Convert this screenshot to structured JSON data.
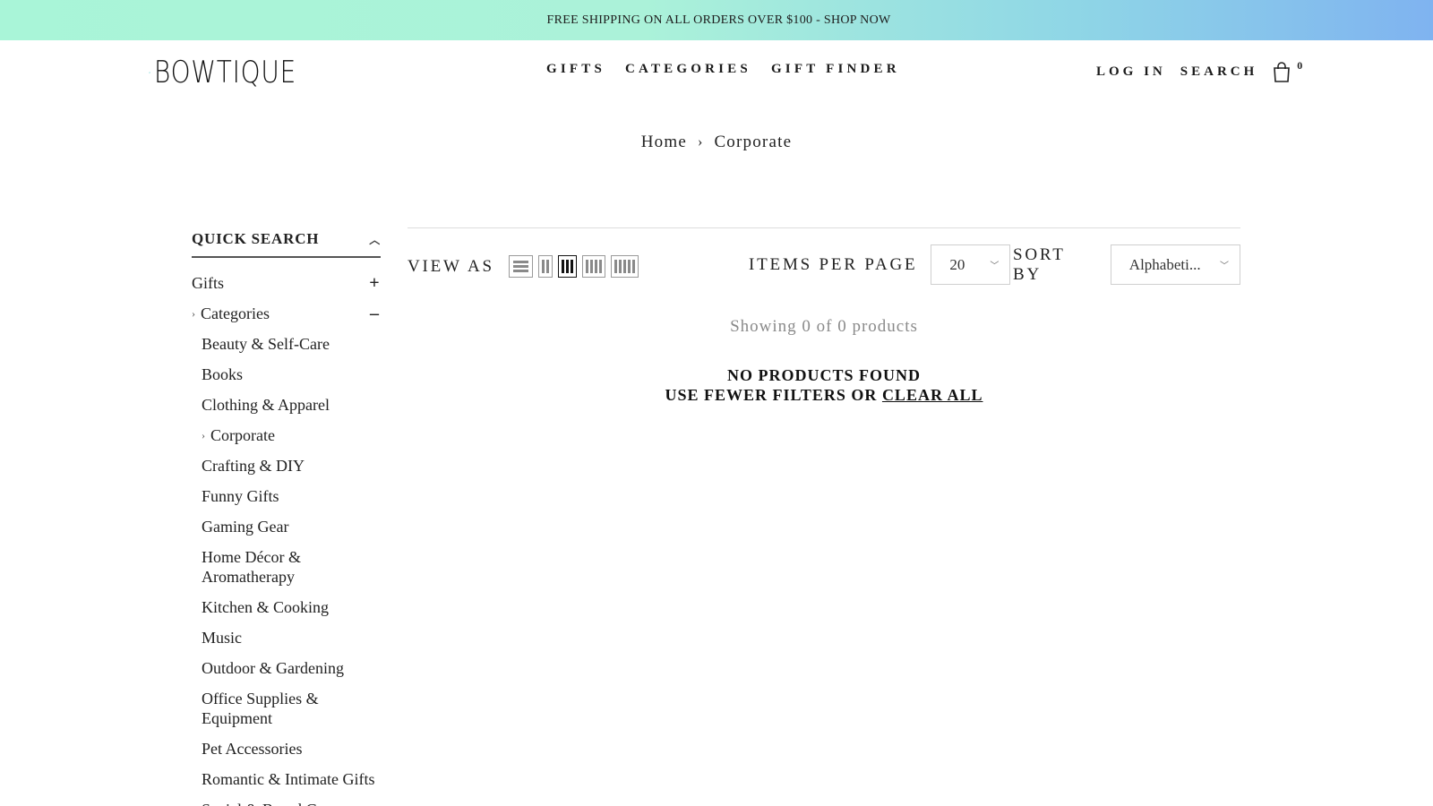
{
  "announcement": {
    "text": "FREE SHIPPING ON ALL ORDERS OVER $100 - SHOP NOW"
  },
  "header": {
    "logo_text": "BOWTIQUE",
    "nav": [
      "GIFTS",
      "CATEGORIES",
      "GIFT FINDER"
    ],
    "login": "LOG IN",
    "search": "SEARCH",
    "cart_count": "0"
  },
  "breadcrumb": {
    "home": "Home",
    "separator": "›",
    "current": "Corporate"
  },
  "sidebar": {
    "quick_search": "QUICK SEARCH",
    "gifts": "Gifts",
    "gifts_toggle": "+",
    "categories": "Categories",
    "categories_toggle": "–",
    "items": [
      "Beauty & Self-Care",
      "Books",
      "Clothing & Apparel",
      "Corporate",
      "Crafting & DIY",
      "Funny Gifts",
      "Gaming Gear",
      "Home Décor & Aromatherapy",
      "Kitchen & Cooking",
      "Music",
      "Outdoor & Gardening",
      "Office Supplies & Equipment",
      "Pet Accessories",
      "Romantic & Intimate Gifts",
      "Social & Board G..."
    ]
  },
  "toolbar": {
    "view_as": "VIEW AS",
    "items_per_page_label": "ITEMS PER PAGE",
    "items_per_page_value": "20",
    "sort_by_label": "SORT BY",
    "sort_by_value": "Alphabeti..."
  },
  "results": {
    "showing": "Showing 0 of 0 products",
    "no_products": "NO PRODUCTS FOUND",
    "fewer_filters": "USE FEWER FILTERS OR",
    "clear_all": "CLEAR ALL"
  },
  "colors": {
    "banner_start": "#a9f5d8",
    "banner_end": "#7fb3f0",
    "logo_accent": "#3cc8c8"
  }
}
